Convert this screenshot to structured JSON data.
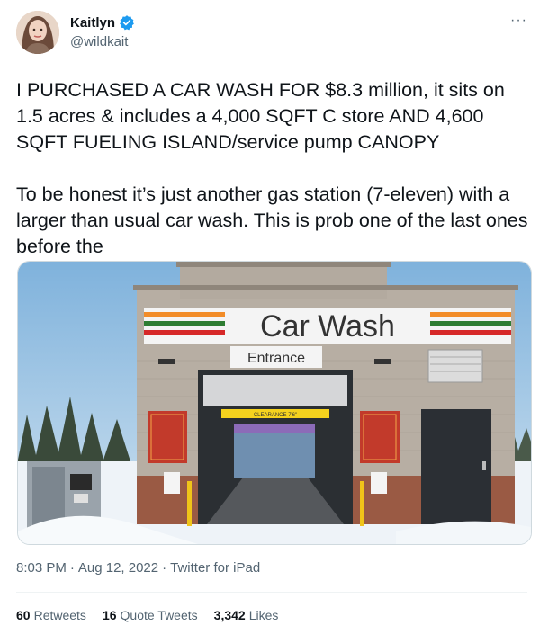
{
  "author": {
    "display_name": "Kaitlyn",
    "handle": "@wildkait",
    "verified_icon": "verified-badge-icon",
    "more_label": "···"
  },
  "tweet": {
    "text": "I PURCHASED A CAR WASH FOR $8.3 million, it sits on 1.5 acres & includes a 4,000 SQFT C store AND 4,600 SQFT FUELING ISLAND/service pump CANOPY\n\nTo be honest it’s just another gas station (7-eleven) with a larger than usual car wash.  This is prob one of the last ones before the"
  },
  "photo": {
    "sign_text": "Car Wash",
    "entrance_text": "Entrance",
    "clearance_text": "CLEARANCE 7'6\""
  },
  "meta": {
    "time": "8:03 PM",
    "sep1": "·",
    "date": "Aug 12, 2022",
    "sep2": "·",
    "source": "Twitter for iPad"
  },
  "stats": {
    "retweets_count": "60",
    "retweets_label": "Retweets",
    "quotes_count": "16",
    "quotes_label": "Quote Tweets",
    "likes_count": "3,342",
    "likes_label": "Likes"
  },
  "colors": {
    "verified": "#1d9bf0",
    "stripe_red": "#d62828",
    "stripe_green": "#2e7d32",
    "stripe_orange": "#f28c28"
  }
}
